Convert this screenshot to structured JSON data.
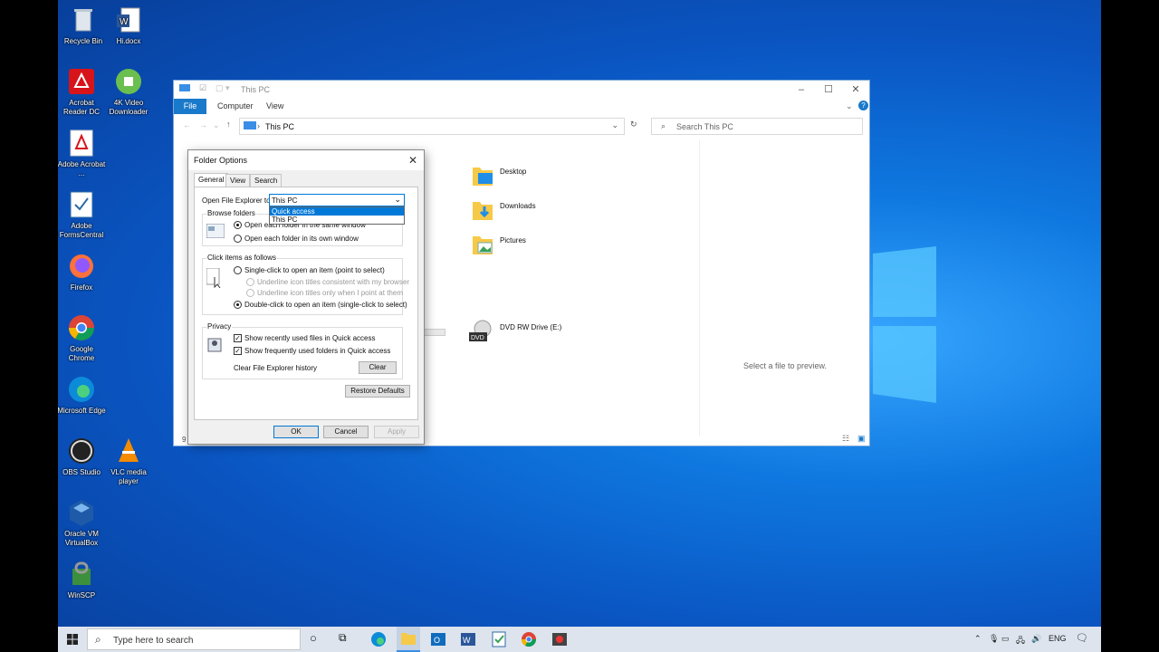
{
  "desktop": {
    "icons": [
      {
        "label": "Recycle Bin"
      },
      {
        "label": "Hi.docx"
      },
      {
        "label": "Acrobat Reader DC"
      },
      {
        "label": "4K Video Downloader"
      },
      {
        "label": "Adobe Acrobat ..."
      },
      {
        "label": "Adobe FormsCentral"
      },
      {
        "label": "Firefox"
      },
      {
        "label": "Google Chrome"
      },
      {
        "label": "Microsoft Edge"
      },
      {
        "label": "OBS Studio"
      },
      {
        "label": "VLC media player"
      },
      {
        "label": "Oracle VM VirtualBox"
      },
      {
        "label": "WinSCP"
      }
    ]
  },
  "explorer": {
    "title": "This PC",
    "ribbon": {
      "file": "File",
      "computer": "Computer",
      "view": "View"
    },
    "address": "This PC",
    "search_placeholder": "Search This PC",
    "folders": [
      {
        "label": "Desktop"
      },
      {
        "label": "Downloads"
      },
      {
        "label": "Pictures"
      }
    ],
    "drive": "DVD RW Drive (E:)",
    "preview": "Select a file to preview.",
    "item_count": "9"
  },
  "dialog": {
    "title": "Folder Options",
    "tabs": [
      "General",
      "View",
      "Search"
    ],
    "open_label": "Open File Explorer to:",
    "combo_value": "This PC",
    "dropdown_options": [
      "Quick access",
      "This PC"
    ],
    "browse_group": "Browse folders",
    "browse_same": "Open each folder in the same window",
    "browse_own": "Open each folder in its own window",
    "click_group": "Click items as follows",
    "single_click": "Single-click to open an item (point to select)",
    "underline_browser": "Underline icon titles consistent with my browser",
    "underline_point": "Underline icon titles only when I point at them",
    "double_click": "Double-click to open an item (single-click to select)",
    "privacy_group": "Privacy",
    "recent_files": "Show recently used files in Quick access",
    "frequent_folders": "Show frequently used folders in Quick access",
    "clear_history": "Clear File Explorer history",
    "clear_btn": "Clear",
    "restore_btn": "Restore Defaults",
    "ok_btn": "OK",
    "cancel_btn": "Cancel",
    "apply_btn": "Apply"
  },
  "taskbar": {
    "search_placeholder": "Type here to search",
    "lang": "ENG"
  },
  "colors": {
    "accent": "#0078d7",
    "desktop": "#0a62cc"
  }
}
